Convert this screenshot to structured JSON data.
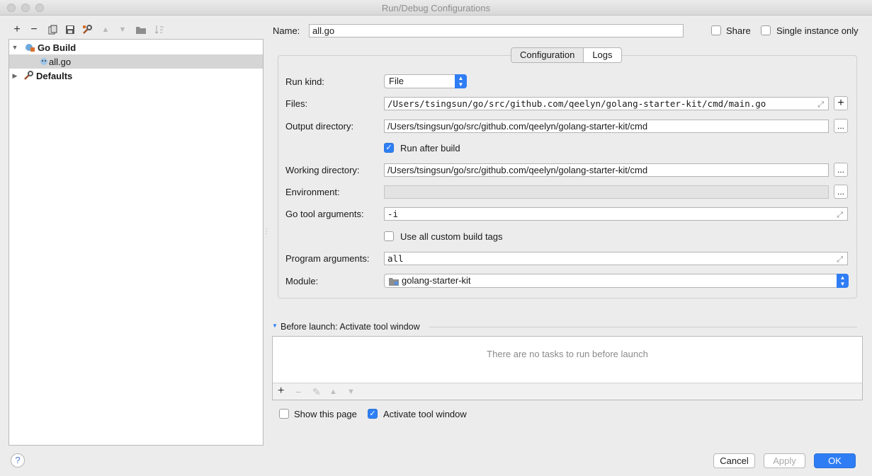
{
  "window": {
    "title": "Run/Debug Configurations"
  },
  "toolbar": [
    "plus-icon",
    "minus-icon",
    "copy-icon",
    "save-icon",
    "wrench-icon",
    "arrow-up-icon",
    "arrow-down-icon",
    "folder-icon",
    "sort-icon"
  ],
  "tree": {
    "group": "Go Build",
    "item": "all.go",
    "defaults": "Defaults"
  },
  "header": {
    "name_label": "Name:",
    "name_value": "all.go",
    "share_label": "Share",
    "single_label": "Single instance only"
  },
  "tabs": {
    "configuration": "Configuration",
    "logs": "Logs"
  },
  "form": {
    "run_kind_label": "Run kind:",
    "run_kind_value": "File",
    "files_label": "Files:",
    "files_value": "/Users/tsingsun/go/src/github.com/qeelyn/golang-starter-kit/cmd/main.go",
    "output_label": "Output directory:",
    "output_value": "/Users/tsingsun/go/src/github.com/qeelyn/golang-starter-kit/cmd",
    "run_after_label": "Run after build",
    "working_label": "Working directory:",
    "working_value": "/Users/tsingsun/go/src/github.com/qeelyn/golang-starter-kit/cmd",
    "env_label": "Environment:",
    "env_value": "",
    "go_tool_label": "Go tool arguments:",
    "go_tool_value": "-i",
    "custom_tags_label": "Use all custom build tags",
    "program_label": "Program arguments:",
    "program_value": "all",
    "module_label": "Module:",
    "module_value": "golang-starter-kit",
    "browse": "..."
  },
  "before_launch": {
    "header": "Before launch: Activate tool window",
    "empty": "There are no tasks to run before launch"
  },
  "options": {
    "show_page": "Show this page",
    "activate_tool": "Activate tool window"
  },
  "buttons": {
    "cancel": "Cancel",
    "apply": "Apply",
    "ok": "OK",
    "help": "?"
  },
  "colors": {
    "accent": "#2f7df4"
  }
}
